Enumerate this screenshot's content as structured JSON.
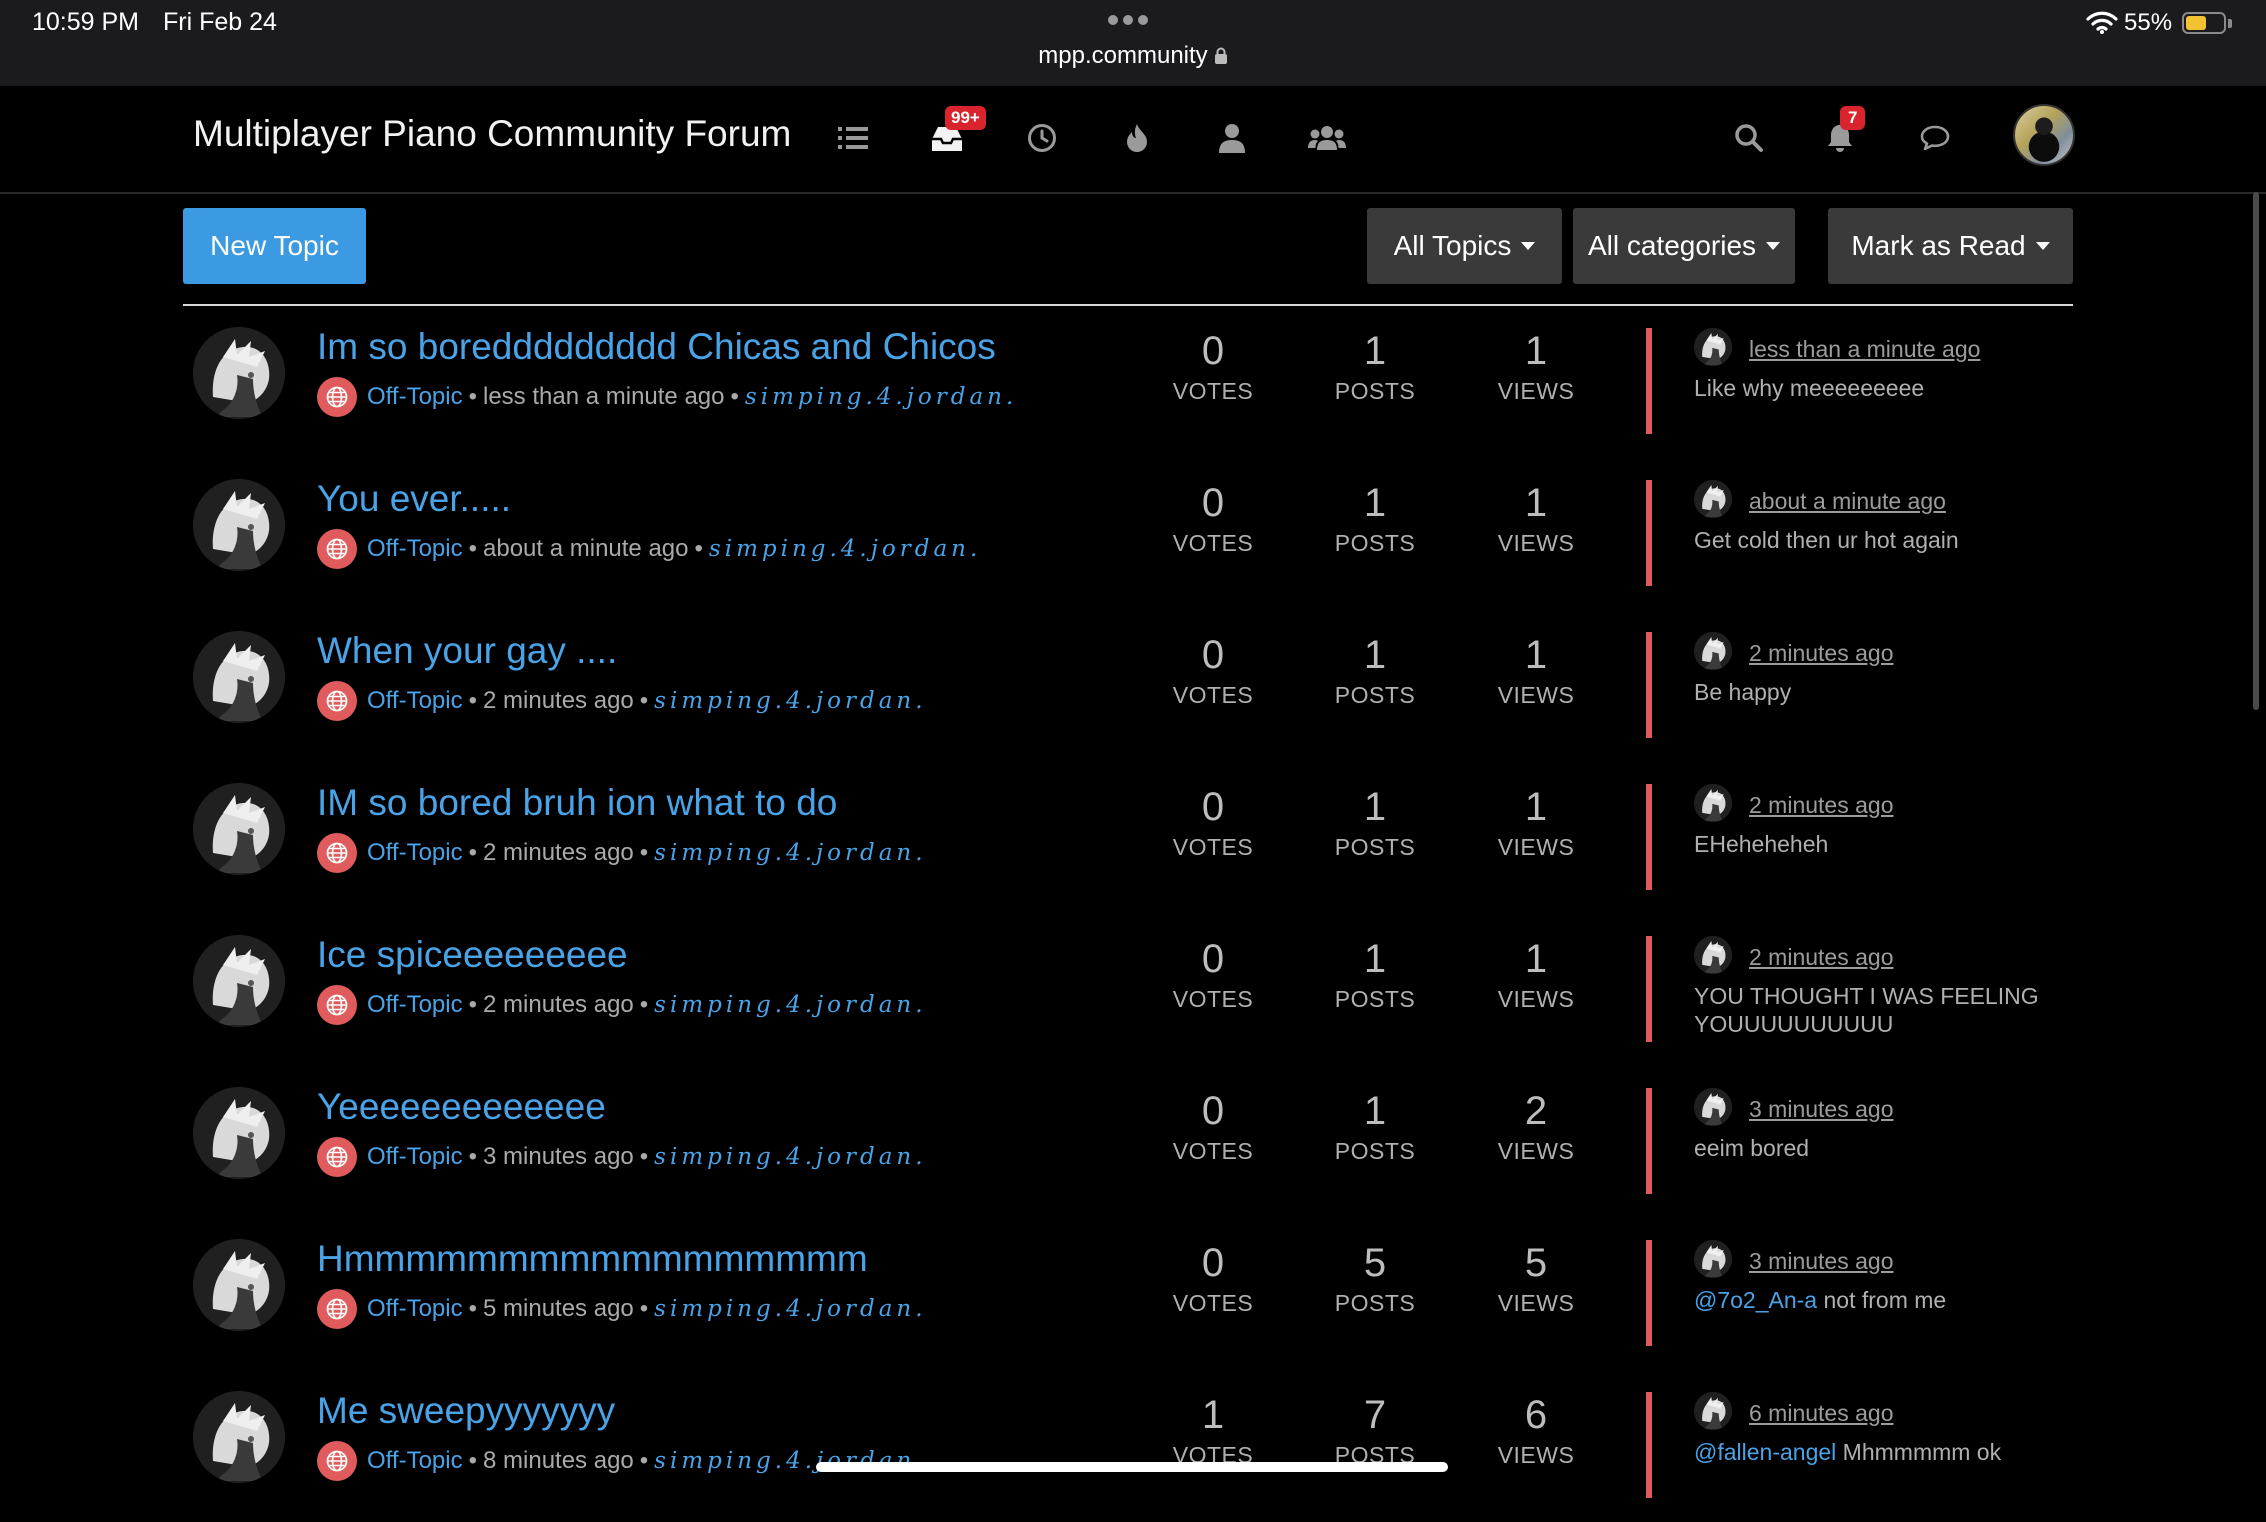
{
  "status_bar": {
    "time": "10:59 PM",
    "date": "Fri Feb 24",
    "url": "mpp.community",
    "battery": "55%",
    "battery_level": 0.55
  },
  "header": {
    "brand": "Multiplayer Piano Community Forum",
    "nav": [
      {
        "icon": "list-icon",
        "badge": ""
      },
      {
        "icon": "inbox-unread-icon",
        "badge": "99+"
      },
      {
        "icon": "clock-recent-icon",
        "badge": ""
      },
      {
        "icon": "fire-popular-icon",
        "badge": ""
      },
      {
        "icon": "user-icon",
        "badge": ""
      },
      {
        "icon": "groups-icon",
        "badge": ""
      }
    ],
    "notifications_badge": "7"
  },
  "toolbar": {
    "new_topic": "New Topic",
    "all_topics": "All Topics",
    "all_categories": "All categories",
    "mark_as_read": "Mark as Read"
  },
  "labels": {
    "votes": "VOTES",
    "posts": "POSTS",
    "views": "VIEWS"
  },
  "topics": [
    {
      "title": "Im so boreddddddddd Chicas and Chicos",
      "category": "Off-Topic",
      "time": "less than a minute ago",
      "author": "simping.4.jordan.",
      "votes": "0",
      "posts": "1",
      "views": "1",
      "last_time": "less than a minute ago",
      "teaser_mention": "",
      "teaser": "Like why meeeeeeeee"
    },
    {
      "title": "You ever.....",
      "category": "Off-Topic",
      "time": "about a minute ago",
      "author": "simping.4.jordan.",
      "votes": "0",
      "posts": "1",
      "views": "1",
      "last_time": "about a minute ago",
      "teaser_mention": "",
      "teaser": "Get cold then ur hot again"
    },
    {
      "title": "When your gay ....",
      "category": "Off-Topic",
      "time": "2 minutes ago",
      "author": "simping.4.jordan.",
      "votes": "0",
      "posts": "1",
      "views": "1",
      "last_time": "2 minutes ago",
      "teaser_mention": "",
      "teaser": "Be happy"
    },
    {
      "title": "IM so bored bruh ion what to do",
      "category": "Off-Topic",
      "time": "2 minutes ago",
      "author": "simping.4.jordan.",
      "votes": "0",
      "posts": "1",
      "views": "1",
      "last_time": "2 minutes ago",
      "teaser_mention": "",
      "teaser": "EHeheheheh"
    },
    {
      "title": "Ice spiceeeeeeeee",
      "category": "Off-Topic",
      "time": "2 minutes ago",
      "author": "simping.4.jordan.",
      "votes": "0",
      "posts": "1",
      "views": "1",
      "last_time": "2 minutes ago",
      "teaser_mention": "",
      "teaser": "YOU THOUGHT I WAS FEELING YOUUUUUUUUUU"
    },
    {
      "title": "Yeeeeeeeeeeeee",
      "category": "Off-Topic",
      "time": "3 minutes ago",
      "author": "simping.4.jordan.",
      "votes": "0",
      "posts": "1",
      "views": "2",
      "last_time": "3 minutes ago",
      "teaser_mention": "",
      "teaser": "eeim bored"
    },
    {
      "title": "Hmmmmmmmmmmmmmmmmm",
      "category": "Off-Topic",
      "time": "5 minutes ago",
      "author": "simping.4.jordan.",
      "votes": "0",
      "posts": "5",
      "views": "5",
      "last_time": "3 minutes ago",
      "teaser_mention": "@7o2_An-a",
      "teaser": " not from me"
    },
    {
      "title": "Me sweepyyyyyyy",
      "category": "Off-Topic",
      "time": "8 minutes ago",
      "author": "simping.4.jordan.",
      "votes": "1",
      "posts": "7",
      "views": "6",
      "last_time": "6 minutes ago",
      "teaser_mention": "@fallen-angel",
      "teaser": " Mhmmmmm ok"
    }
  ],
  "colors": {
    "link": "#4aa3e6",
    "primary_button": "#3b9ae1",
    "category": "#e05b5b",
    "badge": "#d9232d"
  }
}
